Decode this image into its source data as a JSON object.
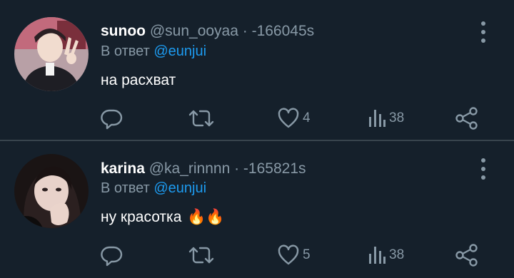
{
  "tweets": [
    {
      "name": "sunoo",
      "handle_time": "@sun_ooyaa · -166045s",
      "reply_prefix": "В ответ",
      "reply_mention": "@eunjui",
      "text": "на расхват",
      "emoji": "",
      "likes": "4",
      "views": "38"
    },
    {
      "name": "karina",
      "handle_time": "@ka_rinnnn · -165821s",
      "reply_prefix": "В ответ",
      "reply_mention": "@eunjui",
      "text": "ну красотка",
      "emoji": "🔥🔥",
      "likes": "5",
      "views": "38"
    }
  ],
  "icons": {
    "reply": "reply-bubble-icon",
    "retweet": "retweet-icon",
    "like": "heart-icon",
    "views": "views-bar-chart-icon",
    "share": "share-icon",
    "more": "vertical-ellipsis-icon"
  },
  "colors": {
    "background": "#15202b",
    "secondary_text": "#8899a6",
    "accent": "#1d9bf0",
    "divider": "#38444d"
  }
}
